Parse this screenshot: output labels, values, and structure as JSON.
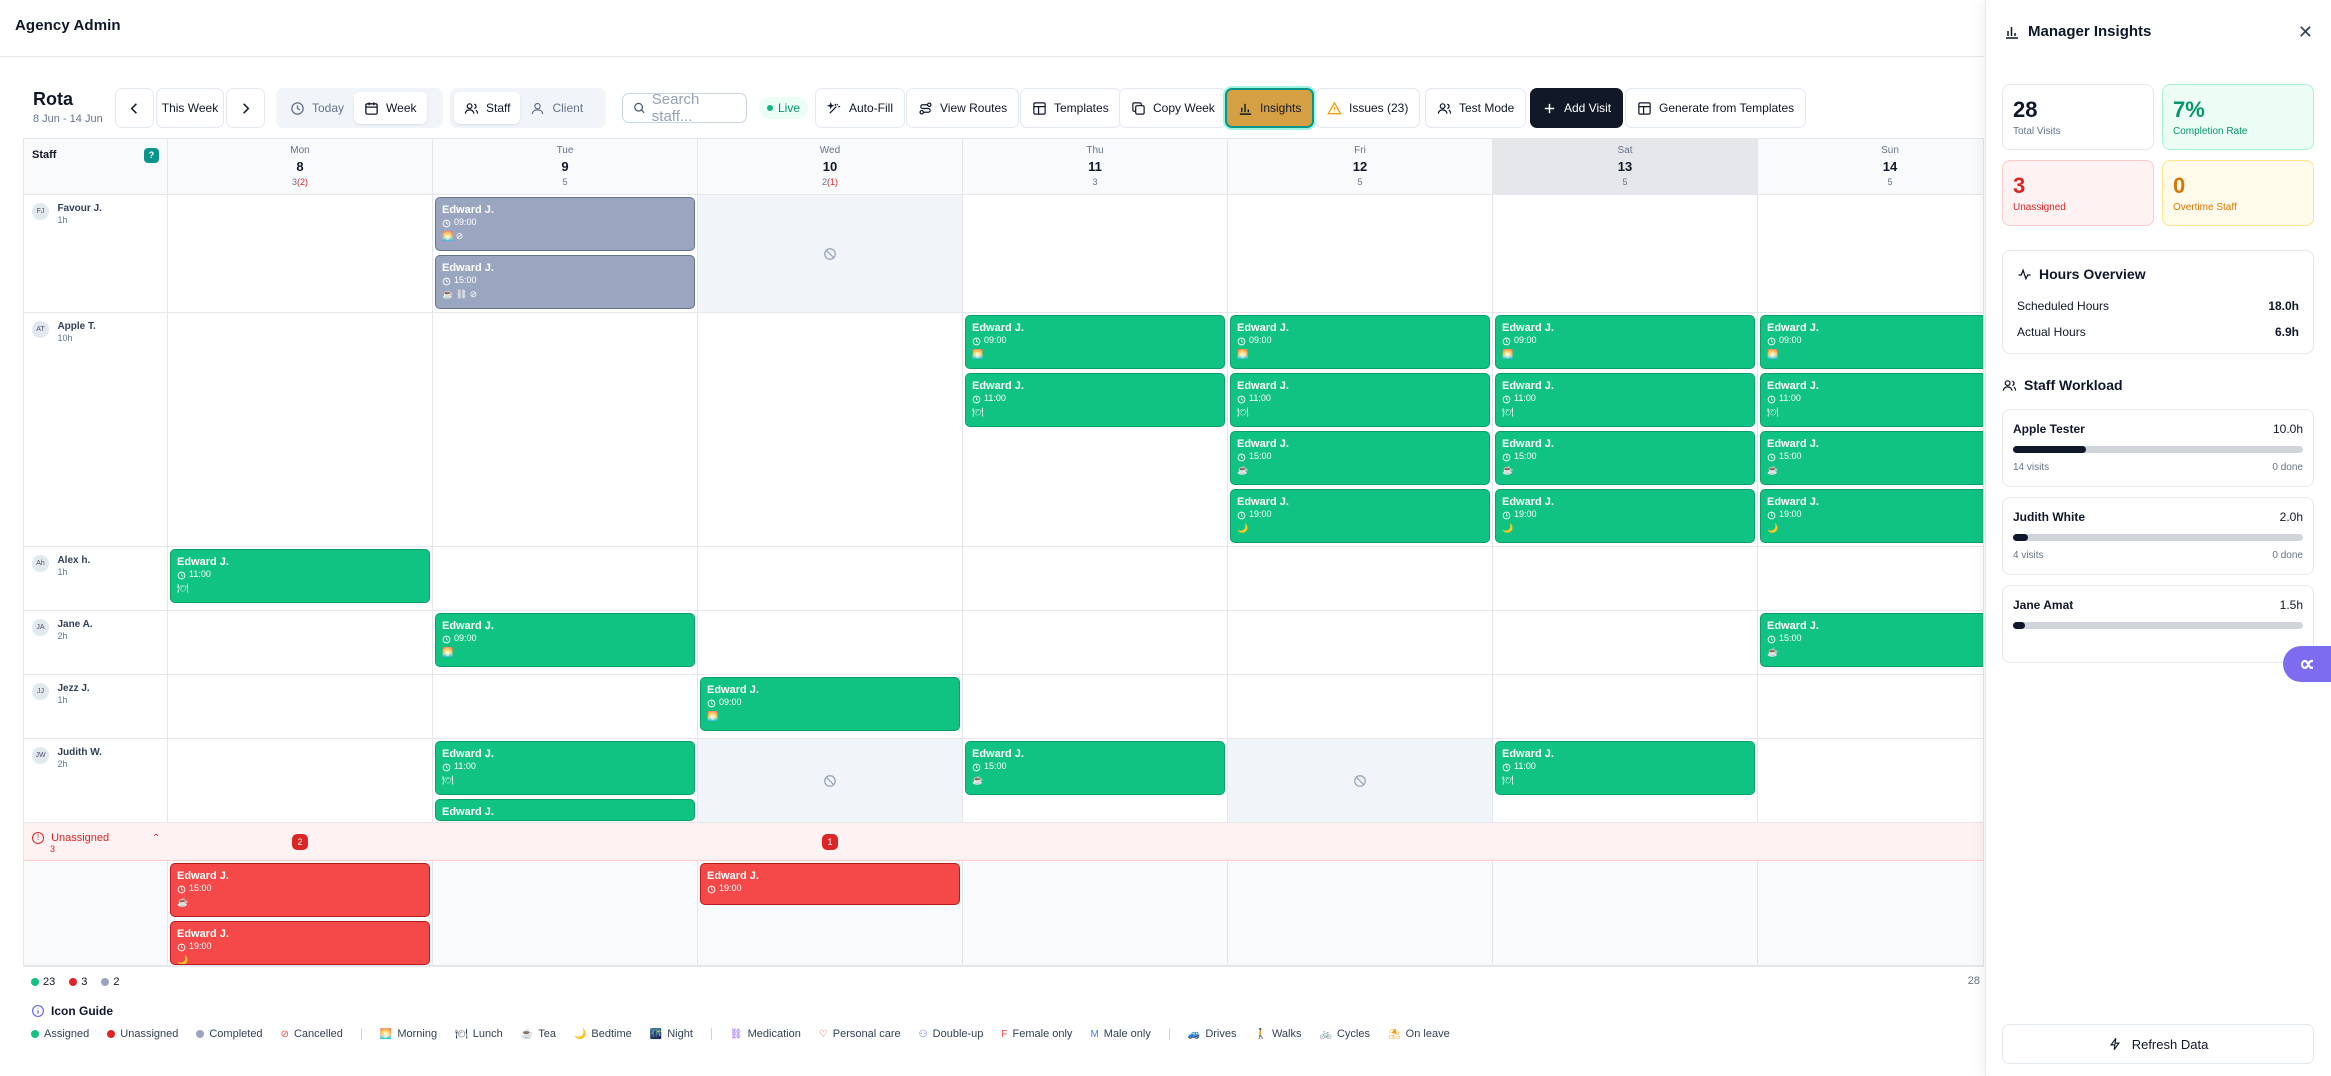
{
  "app": {
    "title": "Agency Admin"
  },
  "rota": {
    "title": "Rota",
    "range": "8 Jun - 14 Jun"
  },
  "toolbar": {
    "this_week": "This Week",
    "today": "Today",
    "week": "Week",
    "staff": "Staff",
    "client": "Client",
    "search_placeholder": "Search staff...",
    "live": "Live",
    "auto_fill": "Auto-Fill",
    "view_routes": "View Routes",
    "templates": "Templates",
    "copy_week": "Copy Week",
    "insights": "Insights",
    "issues": "Issues (23)",
    "test_mode": "Test Mode",
    "add_visit": "Add Visit",
    "generate": "Generate from Templates"
  },
  "grid": {
    "staff_header": "Staff",
    "help": "?",
    "days": [
      {
        "name": "Mon",
        "date": "8",
        "count": "3",
        "count_red": "(2)"
      },
      {
        "name": "Tue",
        "date": "9",
        "count": "5",
        "count_red": ""
      },
      {
        "name": "Wed",
        "date": "10",
        "count": "2",
        "count_red": "(1)"
      },
      {
        "name": "Thu",
        "date": "11",
        "count": "3",
        "count_red": ""
      },
      {
        "name": "Fri",
        "date": "12",
        "count": "5",
        "count_red": ""
      },
      {
        "name": "Sat",
        "date": "13",
        "count": "5",
        "count_red": ""
      },
      {
        "name": "Sun",
        "date": "14",
        "count": "5",
        "count_red": ""
      }
    ],
    "staff": [
      {
        "initials": "FJ",
        "name": "Favour J.",
        "hours": "1h"
      },
      {
        "initials": "AT",
        "name": "Apple T.",
        "hours": "10h"
      },
      {
        "initials": "Ah",
        "name": "Alex h.",
        "hours": "1h"
      },
      {
        "initials": "JA",
        "name": "Jane A.",
        "hours": "2h"
      },
      {
        "initials": "JJ",
        "name": "Jezz J.",
        "hours": "1h"
      },
      {
        "initials": "JW",
        "name": "Judith W.",
        "hours": "2h"
      }
    ],
    "unassigned": {
      "label": "Unassigned",
      "count": "3",
      "mon_badge": "2",
      "wed_badge": "1"
    },
    "visit_name": "Edward J.",
    "times": {
      "t0900": "09:00",
      "t1100": "11:00",
      "t1500": "15:00",
      "t1900": "19:00"
    }
  },
  "legend_counts": {
    "assigned": "23",
    "unassigned": "3",
    "completed": "2",
    "page": "28"
  },
  "icon_guide": {
    "title": "Icon Guide",
    "items": [
      "Assigned",
      "Unassigned",
      "Completed",
      "Cancelled",
      "Morning",
      "Lunch",
      "Tea",
      "Bedtime",
      "Night",
      "Medication",
      "Personal care",
      "Double-up",
      "Female only",
      "Male only",
      "Drives",
      "Walks",
      "Cycles",
      "On leave"
    ]
  },
  "panel": {
    "title": "Manager Insights",
    "total_visits": {
      "value": "28",
      "label": "Total Visits"
    },
    "completion": {
      "value": "7%",
      "label": "Completion Rate"
    },
    "unassigned": {
      "value": "3",
      "label": "Unassigned"
    },
    "overtime": {
      "value": "0",
      "label": "Overtime Staff"
    },
    "hours": {
      "title": "Hours Overview",
      "scheduled_label": "Scheduled Hours",
      "scheduled": "18.0h",
      "actual_label": "Actual Hours",
      "actual": "6.9h"
    },
    "workload_title": "Staff Workload",
    "workload": [
      {
        "name": "Apple Tester",
        "hours": "10.0h",
        "visits": "14 visits",
        "done": "0 done",
        "level": 0.25
      },
      {
        "name": "Judith White",
        "hours": "2.0h",
        "visits": "4 visits",
        "done": "0 done",
        "level": 0.05
      },
      {
        "name": "Jane Amat",
        "hours": "1.5h",
        "visits": "",
        "done": "",
        "level": 0.04
      }
    ],
    "refresh": "Refresh Data"
  },
  "colors": {
    "assigned": "#10c383",
    "unassigned": "#f54848",
    "completed": "#9aa6bf",
    "accent": "#0d9488"
  }
}
